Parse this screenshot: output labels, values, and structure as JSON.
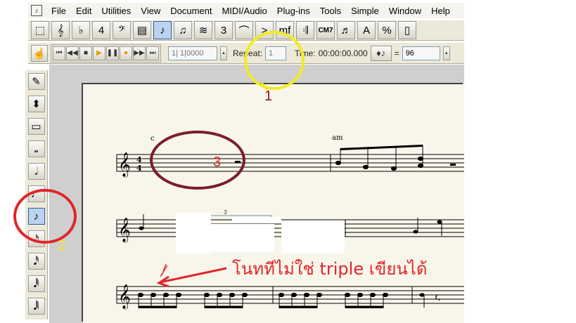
{
  "app": {
    "icon": "app-icon",
    "menu": [
      "File",
      "Edit",
      "Utilities",
      "View",
      "Document",
      "MIDI/Audio",
      "Plug-ins",
      "Tools",
      "Simple",
      "Window",
      "Help"
    ]
  },
  "toolbar_main": {
    "tools": [
      {
        "icon": "selection-tool-icon",
        "glyph": "⬚"
      },
      {
        "icon": "treble-clef-tool-icon",
        "glyph": "𝄞"
      },
      {
        "icon": "key-signature-tool-icon",
        "glyph": "♭"
      },
      {
        "icon": "time-signature-tool-icon",
        "glyph": "4"
      },
      {
        "icon": "bass-clef-tool-icon",
        "glyph": "𝄢"
      },
      {
        "icon": "measure-tool-icon",
        "glyph": "▤"
      },
      {
        "icon": "simple-entry-tool-icon",
        "glyph": "♪"
      },
      {
        "icon": "speedy-entry-tool-icon",
        "glyph": "♫"
      },
      {
        "icon": "hyperscribe-tool-icon",
        "glyph": "≋"
      },
      {
        "icon": "tuplet-tool-icon",
        "glyph": "3"
      },
      {
        "icon": "smart-shape-tool-icon",
        "glyph": "⌒"
      },
      {
        "icon": "articulation-tool-icon",
        "glyph": ">"
      },
      {
        "icon": "expression-tool-icon",
        "glyph": "mf"
      },
      {
        "icon": "repeat-tool-icon",
        "glyph": "𝄇"
      },
      {
        "icon": "chord-tool-icon",
        "glyph": "CM7"
      },
      {
        "icon": "lyrics-tool-icon",
        "glyph": "♬"
      },
      {
        "icon": "text-tool-icon",
        "glyph": "A"
      },
      {
        "icon": "resize-tool-icon",
        "glyph": "%"
      },
      {
        "icon": "page-layout-tool-icon",
        "glyph": "▯"
      }
    ],
    "active_tool_index": 6
  },
  "playback": {
    "counter": "1| 1|0000",
    "repeat_label": "Repeat:",
    "repeat_value": "1",
    "time_label": "Time:",
    "time_value": "00:00:00.000",
    "tempo_eq": "=",
    "tempo_value": "96"
  },
  "left_palette": {
    "tools": [
      "eraser-icon",
      "up-down-arrow-icon",
      "multi-rest-icon",
      "whole-note-icon",
      "half-note-icon",
      "quarter-note-icon",
      "eighth-note-icon",
      "sixteenth-note-icon",
      "thirty-second-note-icon",
      "sixty-fourth-note-icon",
      "one-twenty-eighth-note-icon"
    ],
    "glyphs": [
      "✎",
      "⬍",
      "▭",
      "𝅝",
      "𝅗𝅥",
      "♩",
      "♪",
      "𝅘𝅥𝅯",
      "𝅘𝅥𝅰",
      "𝅘𝅥𝅱",
      "𝅘𝅥𝅲"
    ],
    "active_index": 6
  },
  "score": {
    "chord_c": "c",
    "chord_am": "am",
    "tuplet_mark": "3"
  },
  "annotations": {
    "num1": "1",
    "num2": "2",
    "num3": "3",
    "thai_note": "โนททีไม่ใช่   triple เขียนได้",
    "color_yellow": "#f2ea2a",
    "color_red": "#e0262a",
    "color_maroon": "#7a1e2a"
  }
}
